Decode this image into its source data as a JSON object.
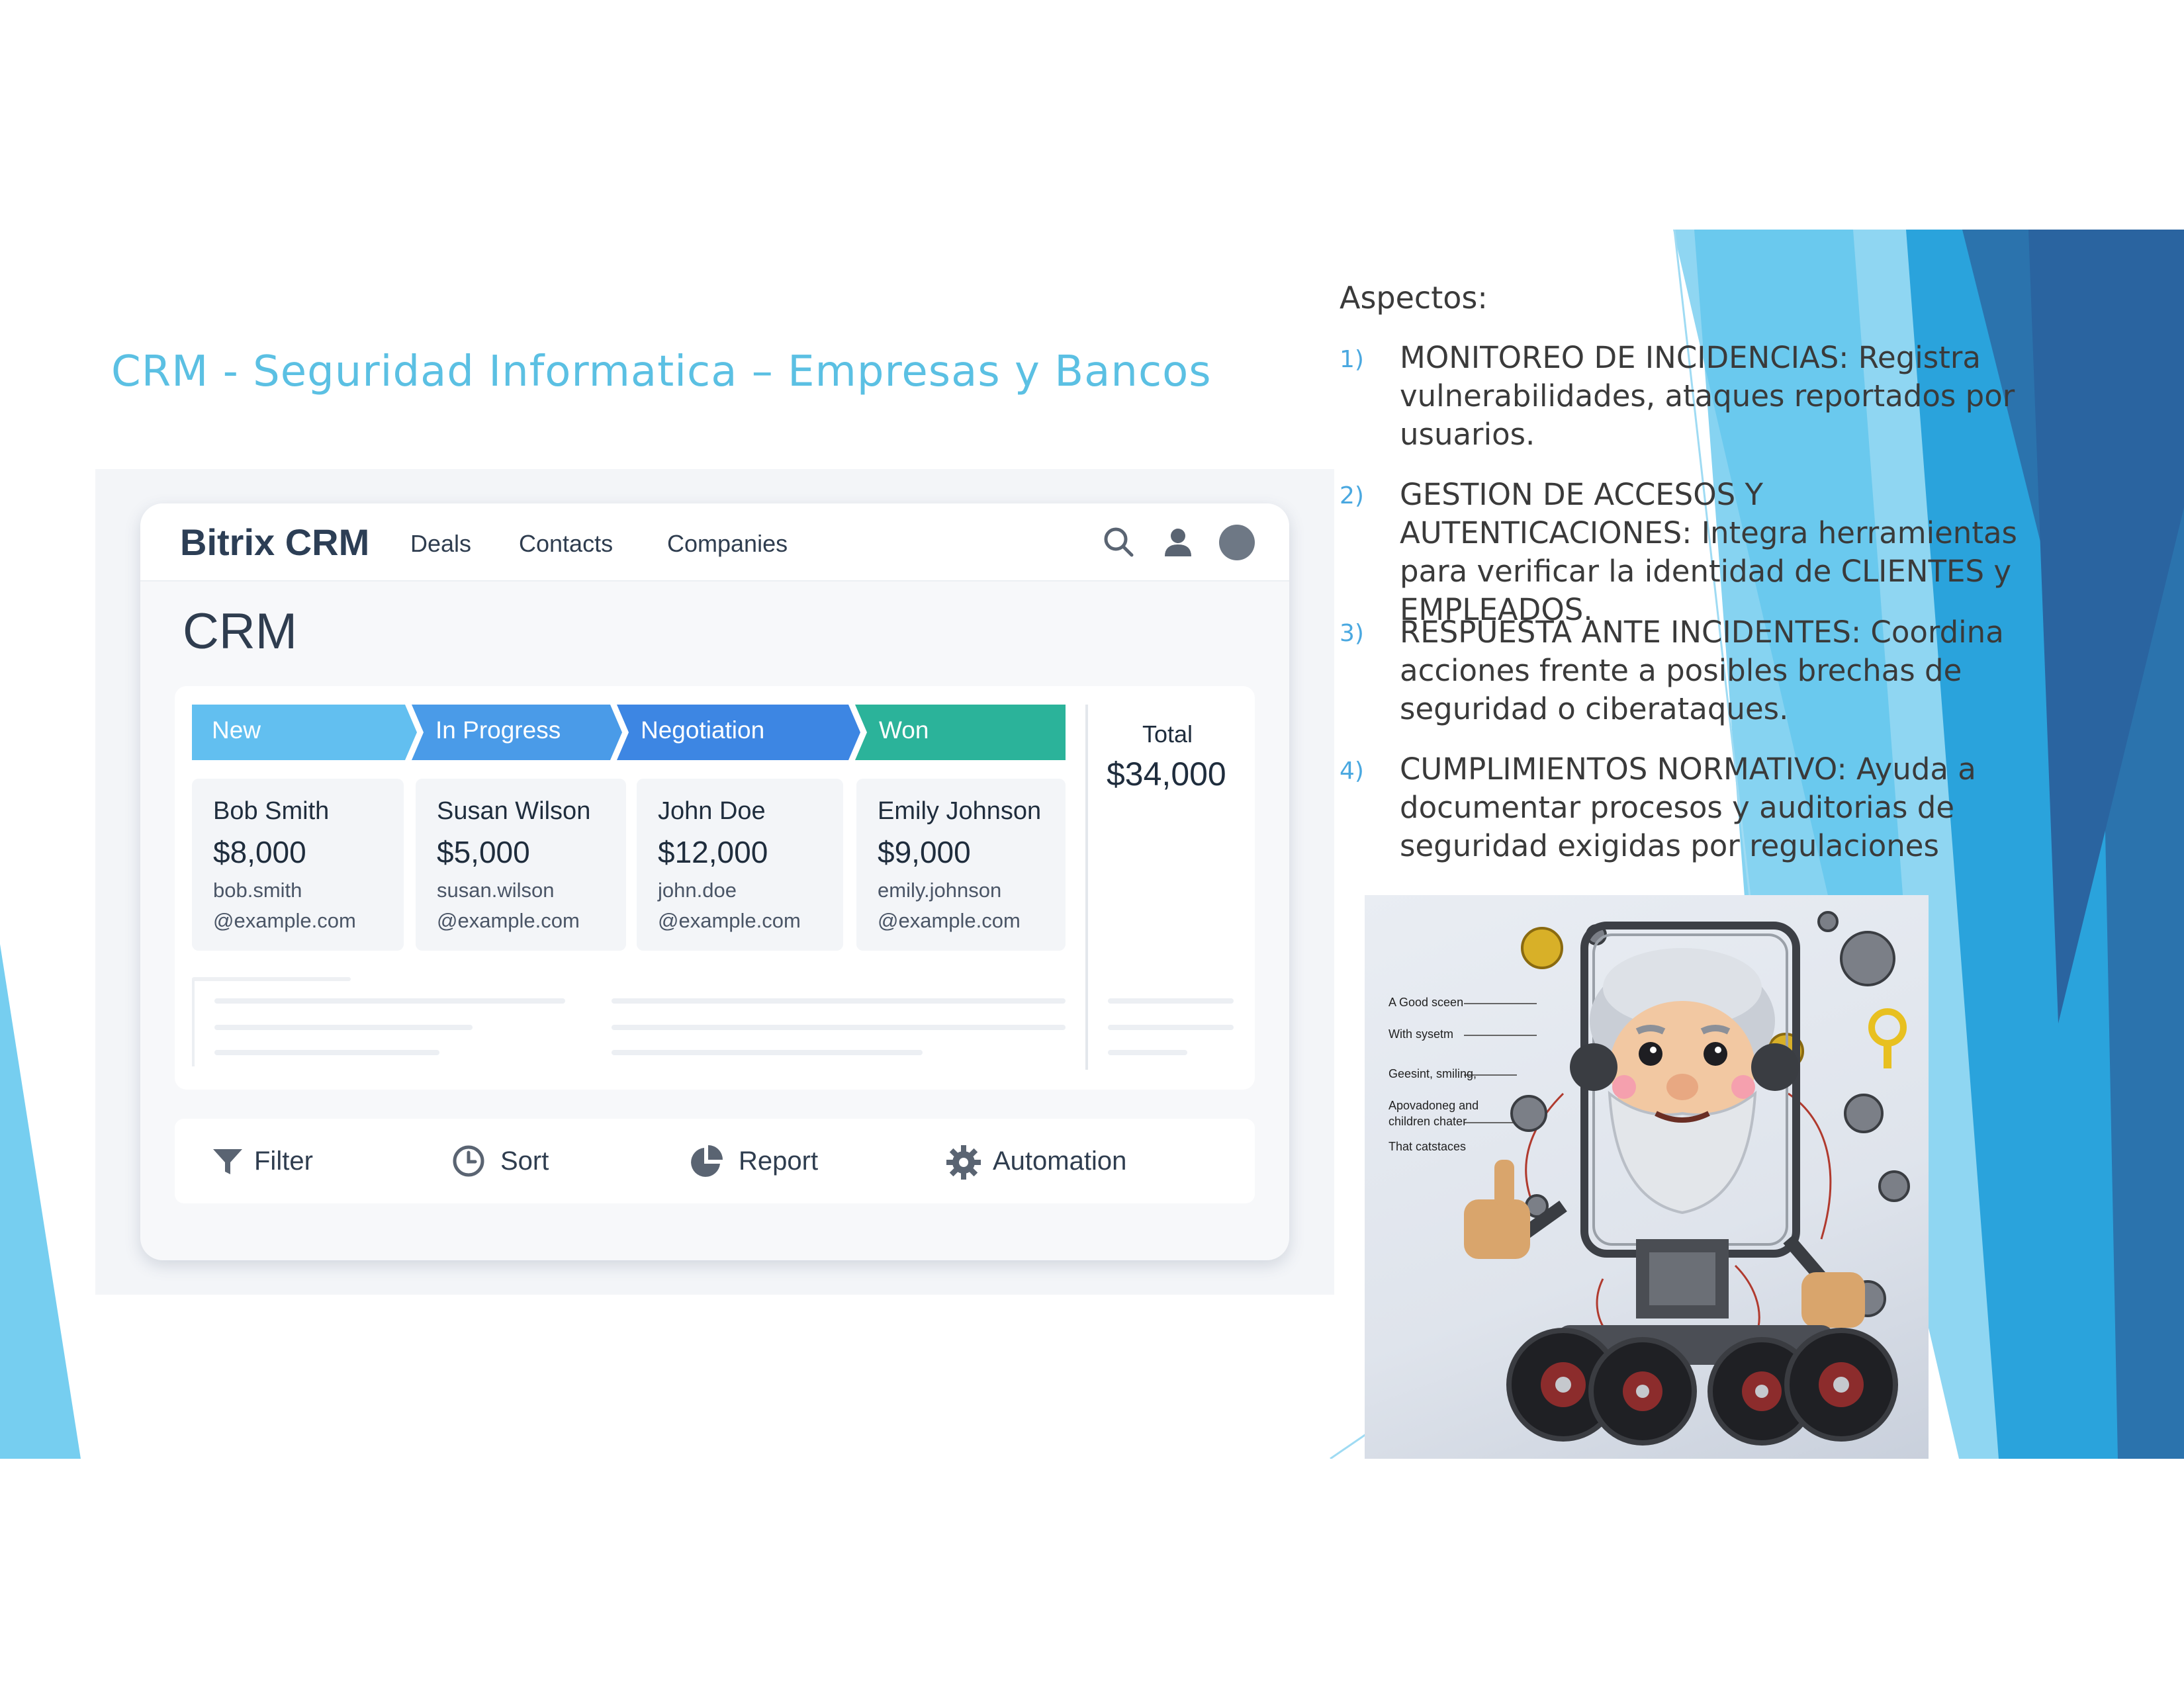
{
  "slide": {
    "title": "CRM - Seguridad Informatica – Empresas y Bancos",
    "aspects_heading": "Aspectos:",
    "aspects": [
      {
        "num": "1)",
        "text": "MONITOREO DE INCIDENCIAS: Registra vulnerabilidades, ataques reportados por usuarios."
      },
      {
        "num": "2)",
        "text": "GESTION DE ACCESOS Y AUTENTICACIONES: Integra herramientas para verificar la identidad de CLIENTES y EMPLEADOS."
      },
      {
        "num": "3)",
        "text": "RESPUESTA ANTE INCIDENTES: Coordina acciones frente a posibles brechas de seguridad o ciberataques."
      },
      {
        "num": "4)",
        "text": "CUMPLIMIENTOS NORMATIVO: Ayuda a documentar procesos y auditorias de seguridad exigidas por regulaciones"
      }
    ],
    "colors": {
      "title": "#5bc0e3",
      "accent_light": "#7fd1ef",
      "accent_dark": "#2a6fa8",
      "number": "#4aa8e0"
    }
  },
  "crm": {
    "logo": "Bitrix CRM",
    "nav": [
      "Deals",
      "Contacts",
      "Companies"
    ],
    "icons": [
      "search-icon",
      "user-icon",
      "avatar"
    ],
    "heading": "CRM",
    "stages": [
      {
        "label": "New",
        "color": "#62bff0"
      },
      {
        "label": "In Progress",
        "color": "#4a9be8"
      },
      {
        "label": "Negotiation",
        "color": "#3d86e3"
      },
      {
        "label": "Won",
        "color": "#2bb39a"
      }
    ],
    "deals": [
      {
        "name": "Bob Smith",
        "amount": "$8,000",
        "email_user": "bob.smith",
        "email_domain": "@example.com"
      },
      {
        "name": "Susan Wilson",
        "amount": "$5,000",
        "email_user": "susan.wilson",
        "email_domain": "@example.com"
      },
      {
        "name": "John Doe",
        "amount": "$12,000",
        "email_user": "john.doe",
        "email_domain": "@example.com"
      },
      {
        "name": "Emily Johnson",
        "amount": "$9,000",
        "email_user": "emily.johnson",
        "email_domain": "@example.com"
      }
    ],
    "total_label": "Total",
    "total_value": "$34,000",
    "toolbar": [
      {
        "label": "Filter",
        "icon": "filter-icon"
      },
      {
        "label": "Sort",
        "icon": "clock-icon"
      },
      {
        "label": "Report",
        "icon": "pie-chart-icon"
      },
      {
        "label": "Automation",
        "icon": "gear-icon"
      }
    ]
  },
  "robot_image": {
    "labels": [
      "A Good sceen",
      "With sysetm",
      "Geesint, smiling,",
      "Apovadoneg and",
      "children chater",
      "That catstaces"
    ]
  }
}
